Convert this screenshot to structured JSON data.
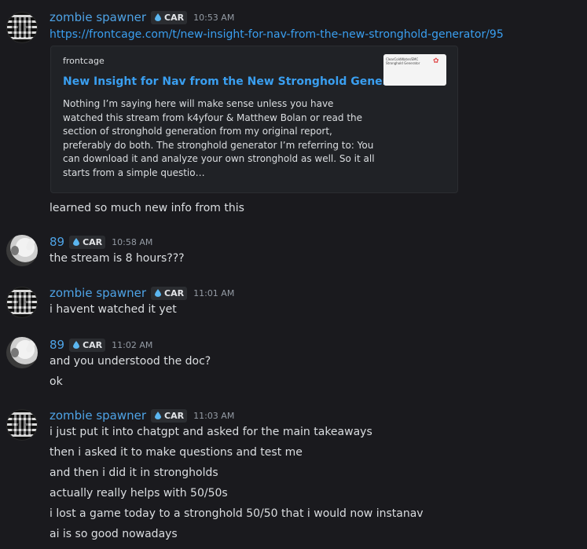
{
  "messages": [
    {
      "user": "zombie spawner",
      "tag": "CAR",
      "time": "10:53 AM",
      "link": "https://frontcage.com/t/new-insight-for-nav-from-the-new-stronghold-generator/95",
      "embed": {
        "provider": "frontcage",
        "title": "New Insight for Nav from the New Stronghold Generator",
        "description": "Nothing I’m saying here will make sense unless you have watched this stream from k4yfour & Matthew Bolan or read the section of stronghold generation from my original report, preferably do both. The stronghold generator I’m referring to: You can download it and analyze your own stronghold as well. So it all starts from a simple questio…",
        "thumb_text": "ClearColdWater/EMC Stronghold Generator"
      },
      "lines": [
        "learned so much new info from this"
      ]
    },
    {
      "user": "89",
      "tag": "CAR",
      "time": "10:58 AM",
      "lines": [
        "the stream is 8 hours???"
      ]
    },
    {
      "user": "zombie spawner",
      "tag": "CAR",
      "time": "11:01 AM",
      "lines": [
        "i havent watched it yet"
      ]
    },
    {
      "user": "89",
      "tag": "CAR",
      "time": "11:02 AM",
      "lines": [
        "and you understood the doc?",
        "ok"
      ]
    },
    {
      "user": "zombie spawner",
      "tag": "CAR",
      "time": "11:03 AM",
      "lines": [
        "i just put it into chatgpt and asked for the main takeaways",
        "then i asked it to make questions and test me",
        "and then i did it in strongholds",
        "actually really helps with 50/50s",
        "i lost a game today to a stronghold 50/50 that i would now instanav",
        "ai is so good nowadays"
      ]
    }
  ],
  "colors": {
    "background": "#1a1a1e",
    "username": "#4ea3e6",
    "link": "#3a9ff0",
    "timestamp": "#949ba4",
    "tag_bg": "#2b2d31"
  },
  "icons": {
    "tag_icon": "water-drop-icon"
  }
}
